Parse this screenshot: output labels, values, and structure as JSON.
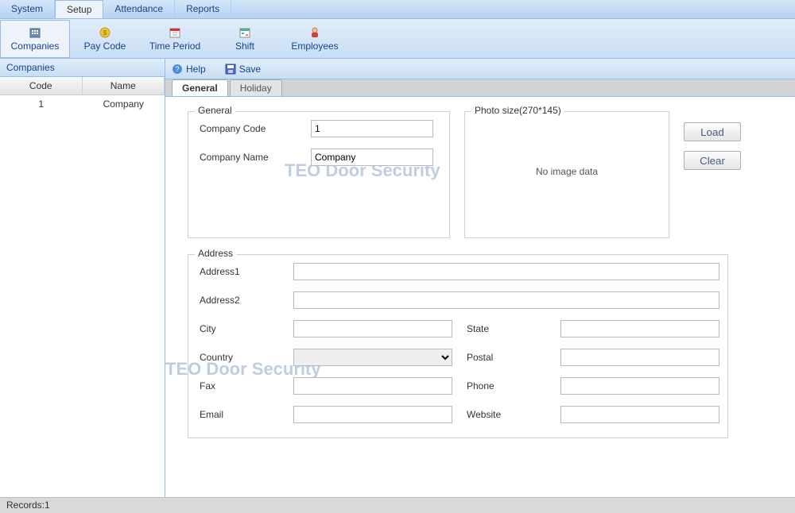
{
  "menubar": [
    "System",
    "Setup",
    "Attendance",
    "Reports"
  ],
  "menubar_active": 1,
  "toolbar": [
    {
      "label": "Companies"
    },
    {
      "label": "Pay Code"
    },
    {
      "label": "Time Period"
    },
    {
      "label": "Shift"
    },
    {
      "label": "Employees"
    }
  ],
  "toolbar_selected": 0,
  "sidebar": {
    "title": "Companies",
    "columns": [
      "Code",
      "Name"
    ],
    "rows": [
      {
        "code": "1",
        "name": "Company"
      }
    ]
  },
  "actions": {
    "help": "Help",
    "save": "Save"
  },
  "tabs": [
    "General",
    "Holiday"
  ],
  "tab_active": 0,
  "form": {
    "general_legend": "General",
    "company_code_label": "Company Code",
    "company_code_value": "1",
    "company_name_label": "Company Name",
    "company_name_value": "Company",
    "photo_legend": "Photo size(270*145)",
    "no_image": "No image data",
    "load": "Load",
    "clear": "Clear",
    "address_legend": "Address",
    "address1_label": "Address1",
    "address1_value": "",
    "address2_label": "Address2",
    "address2_value": "",
    "city_label": "City",
    "city_value": "",
    "state_label": "State",
    "state_value": "",
    "country_label": "Country",
    "country_value": "",
    "postal_label": "Postal",
    "postal_value": "",
    "fax_label": "Fax",
    "fax_value": "",
    "phone_label": "Phone",
    "phone_value": "",
    "email_label": "Email",
    "email_value": "",
    "website_label": "Website",
    "website_value": ""
  },
  "status": "Records:1",
  "watermark": "TEO Door Security"
}
